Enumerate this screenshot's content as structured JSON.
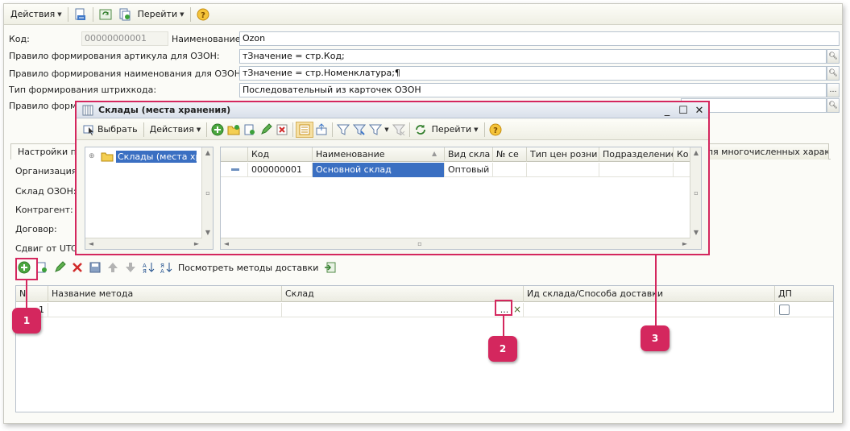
{
  "toolbar": {
    "actions_label": "Действия",
    "goto_label": "Перейти"
  },
  "form": {
    "code_label": "Код:",
    "code_value": "00000000001",
    "name_label": "Наименование:",
    "name_value": "Ozon",
    "rule_article_label": "Правило формирования артикула для ОЗОН:",
    "rule_article_value": "тЗначение = стр.Код;",
    "rule_name_label": "Правило формирования наименования для ОЗОН:",
    "rule_name_value": "тЗначение = стр.Номенклатура;¶",
    "barcode_label": "Тип формирования штрихкода:",
    "barcode_value": "Последовательный из карточек ОЗОН",
    "rule_other_label": "Правило форми"
  },
  "tabs": {
    "left": "Настройки по",
    "right": "ля многочисленных харак"
  },
  "settings": {
    "org_label": "Организация:",
    "warehouse_label": "Склад ОЗОН:",
    "contractor_label": "Контрагент:",
    "contract_label": "Договор:",
    "utc_label": "Сдвиг от UTC"
  },
  "methods_toolbar": {
    "view_label": "Посмотреть методы доставки"
  },
  "methods_grid": {
    "columns": [
      "N",
      "Название метода",
      "Склад",
      "Ид склада/Способа доставки",
      "ДП"
    ],
    "row_number": "1",
    "pick_button": "...",
    "clear_button": "×"
  },
  "modal": {
    "title": "Склады (места хранения)",
    "select_label": "Выбрать",
    "actions_label": "Действия",
    "goto_label": "Перейти",
    "tree_root": "Склады (места хра",
    "columns": [
      "Код",
      "Наименование",
      "Вид скла",
      "№ се",
      "Тип цен розни",
      "Подразделение",
      "Ко"
    ],
    "row": {
      "code": "000000001",
      "name": "Основной склад",
      "kind": "Оптовый"
    }
  },
  "callouts": [
    "1",
    "2",
    "3"
  ],
  "colors": {
    "accent": "#d4275e",
    "selection": "#3a6fc2"
  }
}
